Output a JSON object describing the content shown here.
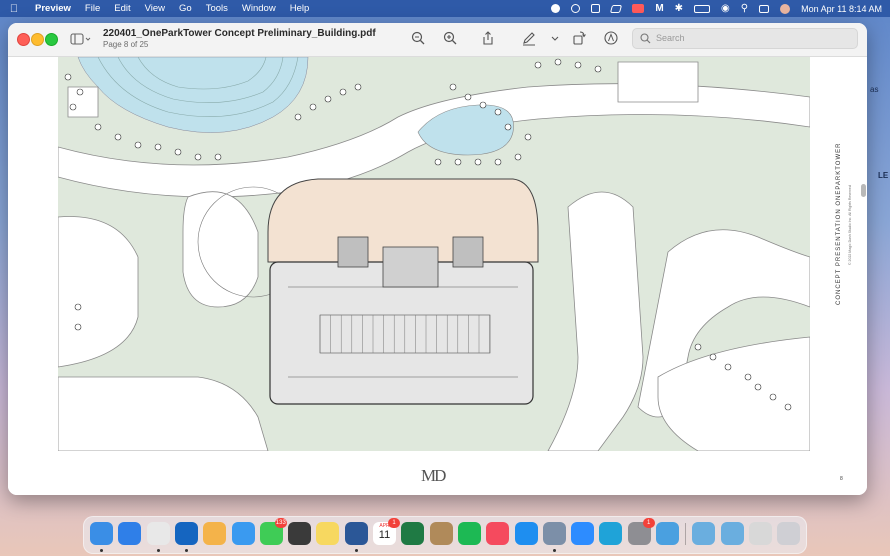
{
  "menubar": {
    "app_name": "Preview",
    "items": [
      "File",
      "Edit",
      "View",
      "Go",
      "Tools",
      "Window",
      "Help"
    ],
    "clock": "Mon Apr 11  8:14 AM"
  },
  "window": {
    "title": "220401_OneParkTower Concept Preliminary_Building.pdf",
    "subtitle": "Page 8 of 25",
    "search_placeholder": "Search"
  },
  "document": {
    "vertical_caption": "CONCEPT PRESENTATION  ONEPARKTOWER",
    "copyright": "© 2022 Magic Dash Studio Inc. All Rights Reserved",
    "logo": "MD",
    "page_number": "8"
  },
  "background_fragments": [
    "as",
    "LE"
  ],
  "dock": {
    "apps": [
      {
        "name": "finder-icon",
        "color": "#3a8ee6"
      },
      {
        "name": "safari-icon",
        "color": "#2f7fe8"
      },
      {
        "name": "chrome-icon",
        "color": "#e8e8e8"
      },
      {
        "name": "outlook-icon",
        "color": "#1565c0"
      },
      {
        "name": "photos-icon",
        "color": "#f4b34a"
      },
      {
        "name": "mail-icon",
        "color": "#3a9af0"
      },
      {
        "name": "messages-icon",
        "color": "#3fcc56",
        "badge": "133"
      },
      {
        "name": "calculator-icon",
        "color": "#3a3a3a"
      },
      {
        "name": "notes-icon",
        "color": "#f7d860"
      },
      {
        "name": "word-icon",
        "color": "#2b5797"
      },
      {
        "name": "calendar-icon",
        "color": "#ffffff",
        "badge": "1",
        "month": "APR",
        "day": "11"
      },
      {
        "name": "excel-icon",
        "color": "#1f7a44"
      },
      {
        "name": "contacts-icon",
        "color": "#b08a5a"
      },
      {
        "name": "spotify-icon",
        "color": "#1db954"
      },
      {
        "name": "music-icon",
        "color": "#f54a5e"
      },
      {
        "name": "app-store-icon",
        "color": "#1e8ef0"
      },
      {
        "name": "preview-icon",
        "color": "#7c8fa8"
      },
      {
        "name": "zoom-icon",
        "color": "#2d8cff"
      },
      {
        "name": "touch-id-icon",
        "color": "#1fa3d8"
      },
      {
        "name": "system-preferences-icon",
        "color": "#8e8e93",
        "badge": "1"
      },
      {
        "name": "network-globe-icon",
        "color": "#4aa0e0"
      },
      {
        "name": "downloads-folder-icon",
        "color": "#6aaedf"
      },
      {
        "name": "applications-folder-icon",
        "color": "#6aaedf"
      },
      {
        "name": "document-stack-icon",
        "color": "#d8d8d8"
      },
      {
        "name": "trash-icon",
        "color": "#cfcfd4"
      }
    ]
  }
}
